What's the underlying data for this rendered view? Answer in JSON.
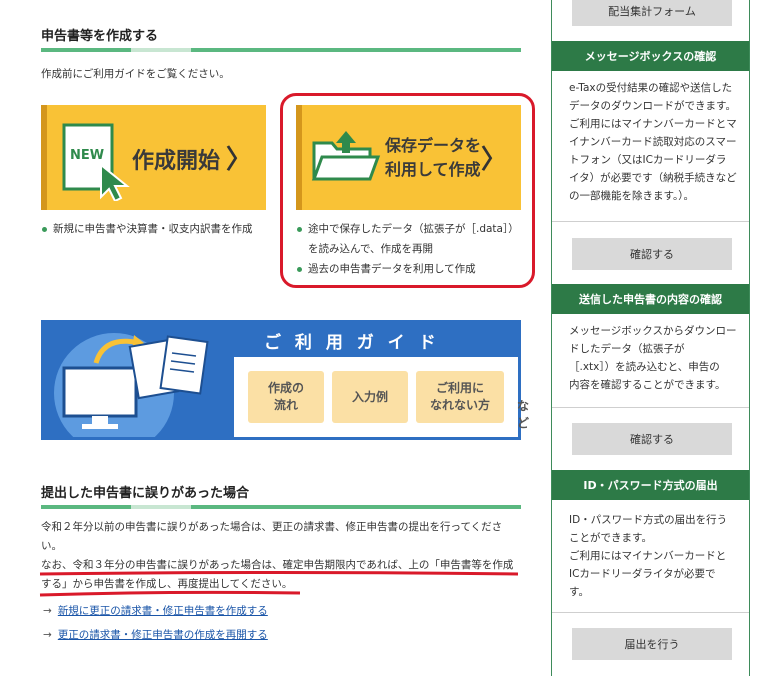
{
  "section1": {
    "title": "申告書等を作成する",
    "intro": "作成前にご利用ガイドをご覧ください。",
    "btn_new": {
      "icon_text": "NEW",
      "label": "作成開始"
    },
    "btn_saved": {
      "label_line1": "保存データを",
      "label_line2": "利用して作成"
    },
    "new_bullets": [
      "新規に申告書や決算書・収支内訳書を作成"
    ],
    "saved_bullets": [
      "途中で保存したデータ（拡張子が［.data］）",
      "を読み込んで、作成を再開",
      "過去の申告書データを利用して作成"
    ]
  },
  "guide": {
    "title": "ご 利 用 ガ イ ド",
    "box1_l1": "作成の",
    "box1_l2": "流れ",
    "box2": "入力例",
    "box3_l1": "ご利用に",
    "box3_l2": "なれない方",
    "etc": "など"
  },
  "section2": {
    "title": "提出した申告書に誤りがあった場合",
    "p1_l1": "令和２年分以前の申告書に誤りがあった場合は、更正の請求書、修正申告書の提出を行ってくださ",
    "p1_l2": "い。",
    "p2_l1": "なお、令和３年分の申告書に誤りがあった場合は、確定申告期限内であれば、上の「申告書等を作成",
    "p2_l2": "する」から申告書を作成し、再度提出してください。",
    "link1": "新規に更正の請求書・修正申告書を作成する",
    "link2": "更正の請求書・修正申告書の作成を再開する"
  },
  "sidebar": {
    "top_button": "配当集計フォーム",
    "msgbox": {
      "head": "メッセージボックスの確認",
      "lines": [
        "e-Taxの受付結果の確認や送信した",
        "データのダウンロードができます。",
        "ご利用にはマイナンバーカードとマ",
        "イナンバーカード読取対応のスマー",
        "トフォン（又はICカードリーダラ",
        "イタ）が必要です（納税手続きなど",
        "の一部機能を除きます。）。"
      ],
      "button": "確認する"
    },
    "sent": {
      "head": "送信した申告書の内容の確認",
      "lines": [
        "メッセージボックスからダウンロー",
        "ドしたデータ（拡張子が",
        "［.xtx］）を読み込むと、申告の",
        "内容を確認することができます。"
      ],
      "button": "確認する"
    },
    "idpw": {
      "head": "ID・パスワード方式の届出",
      "lines": [
        "ID・パスワード方式の届出を行う",
        "ことができます。",
        "ご利用にはマイナンバーカードと",
        "ICカードリーダライタが必要で",
        "す。"
      ],
      "button": "届出を行う"
    }
  },
  "colors": {
    "green": "#2d7a47",
    "yellow": "#f9c236",
    "blue": "#2e6fc2",
    "red": "#d9192a"
  }
}
